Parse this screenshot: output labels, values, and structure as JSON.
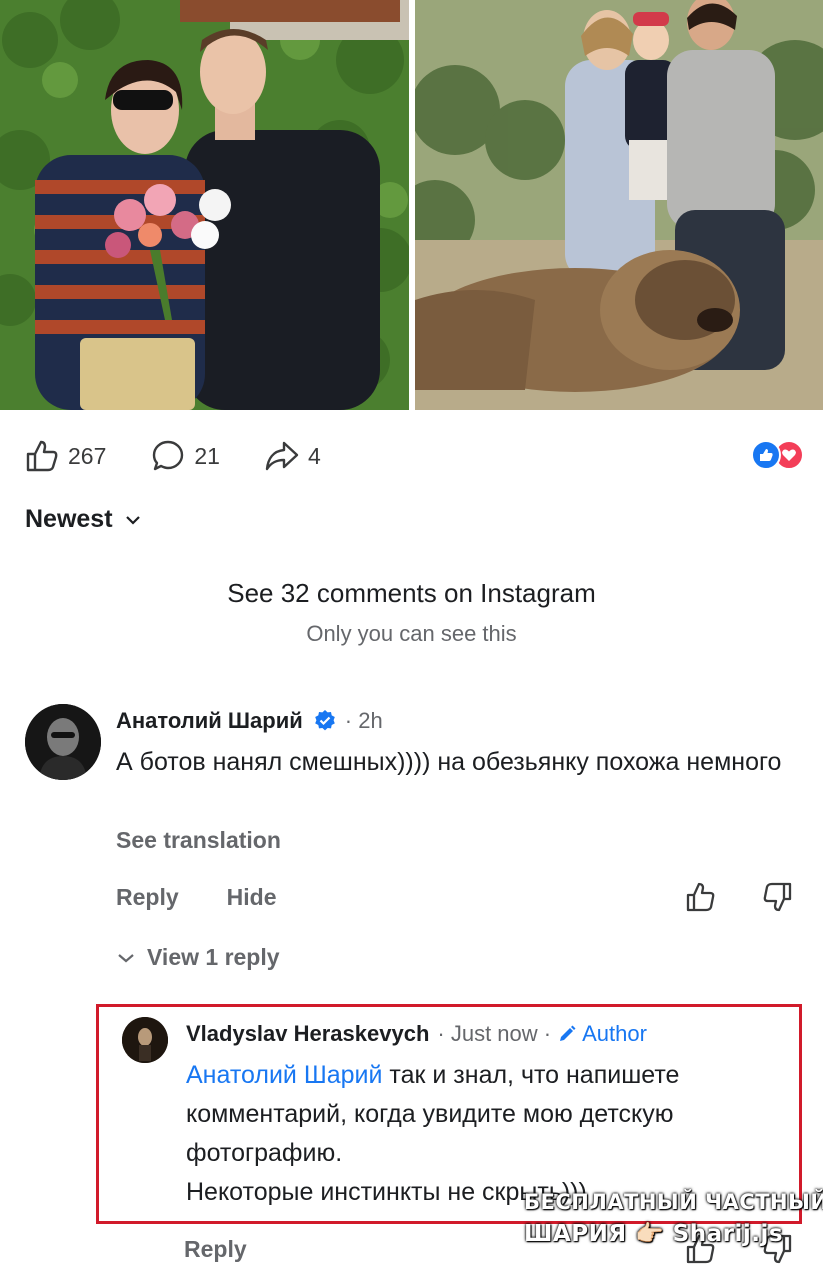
{
  "post": {
    "stats": {
      "likes": "267",
      "comments": "21",
      "shares": "4"
    },
    "reactions": [
      "like-icon",
      "love-icon"
    ]
  },
  "sort": {
    "label": "Newest"
  },
  "instagram": {
    "link": "See 32 comments on Instagram",
    "note": "Only you can see this"
  },
  "comment": {
    "author": "Анатолий Шарий",
    "verified": true,
    "time": "· 2h",
    "text": "А ботов нанял смешных)))) на обезьянку похожа немного",
    "see_translation": "See translation",
    "reply_label": "Reply",
    "hide_label": "Hide",
    "view_replies": "View 1 reply"
  },
  "reply": {
    "author": "Vladyslav Heraskevych",
    "time": "· Just now ·",
    "badge": "Author",
    "mention": "Анатолий Шарий",
    "text": " так и знал, что напишете комментарий, когда увидите мою детскую фотографию.",
    "text2": "Некоторые инстинкты не скрыть)))",
    "reply_label": "Reply",
    "highlight_color": "#d11a2a"
  },
  "watermark": {
    "line1": "БЕСПЛАТНЫЙ ЧАСТНЫЙ",
    "line2": "ШАРИЯ 👉🏻 Sharij.js"
  },
  "colors": {
    "link": "#1877f2",
    "muted": "#65676b",
    "text": "#1c1e21"
  }
}
